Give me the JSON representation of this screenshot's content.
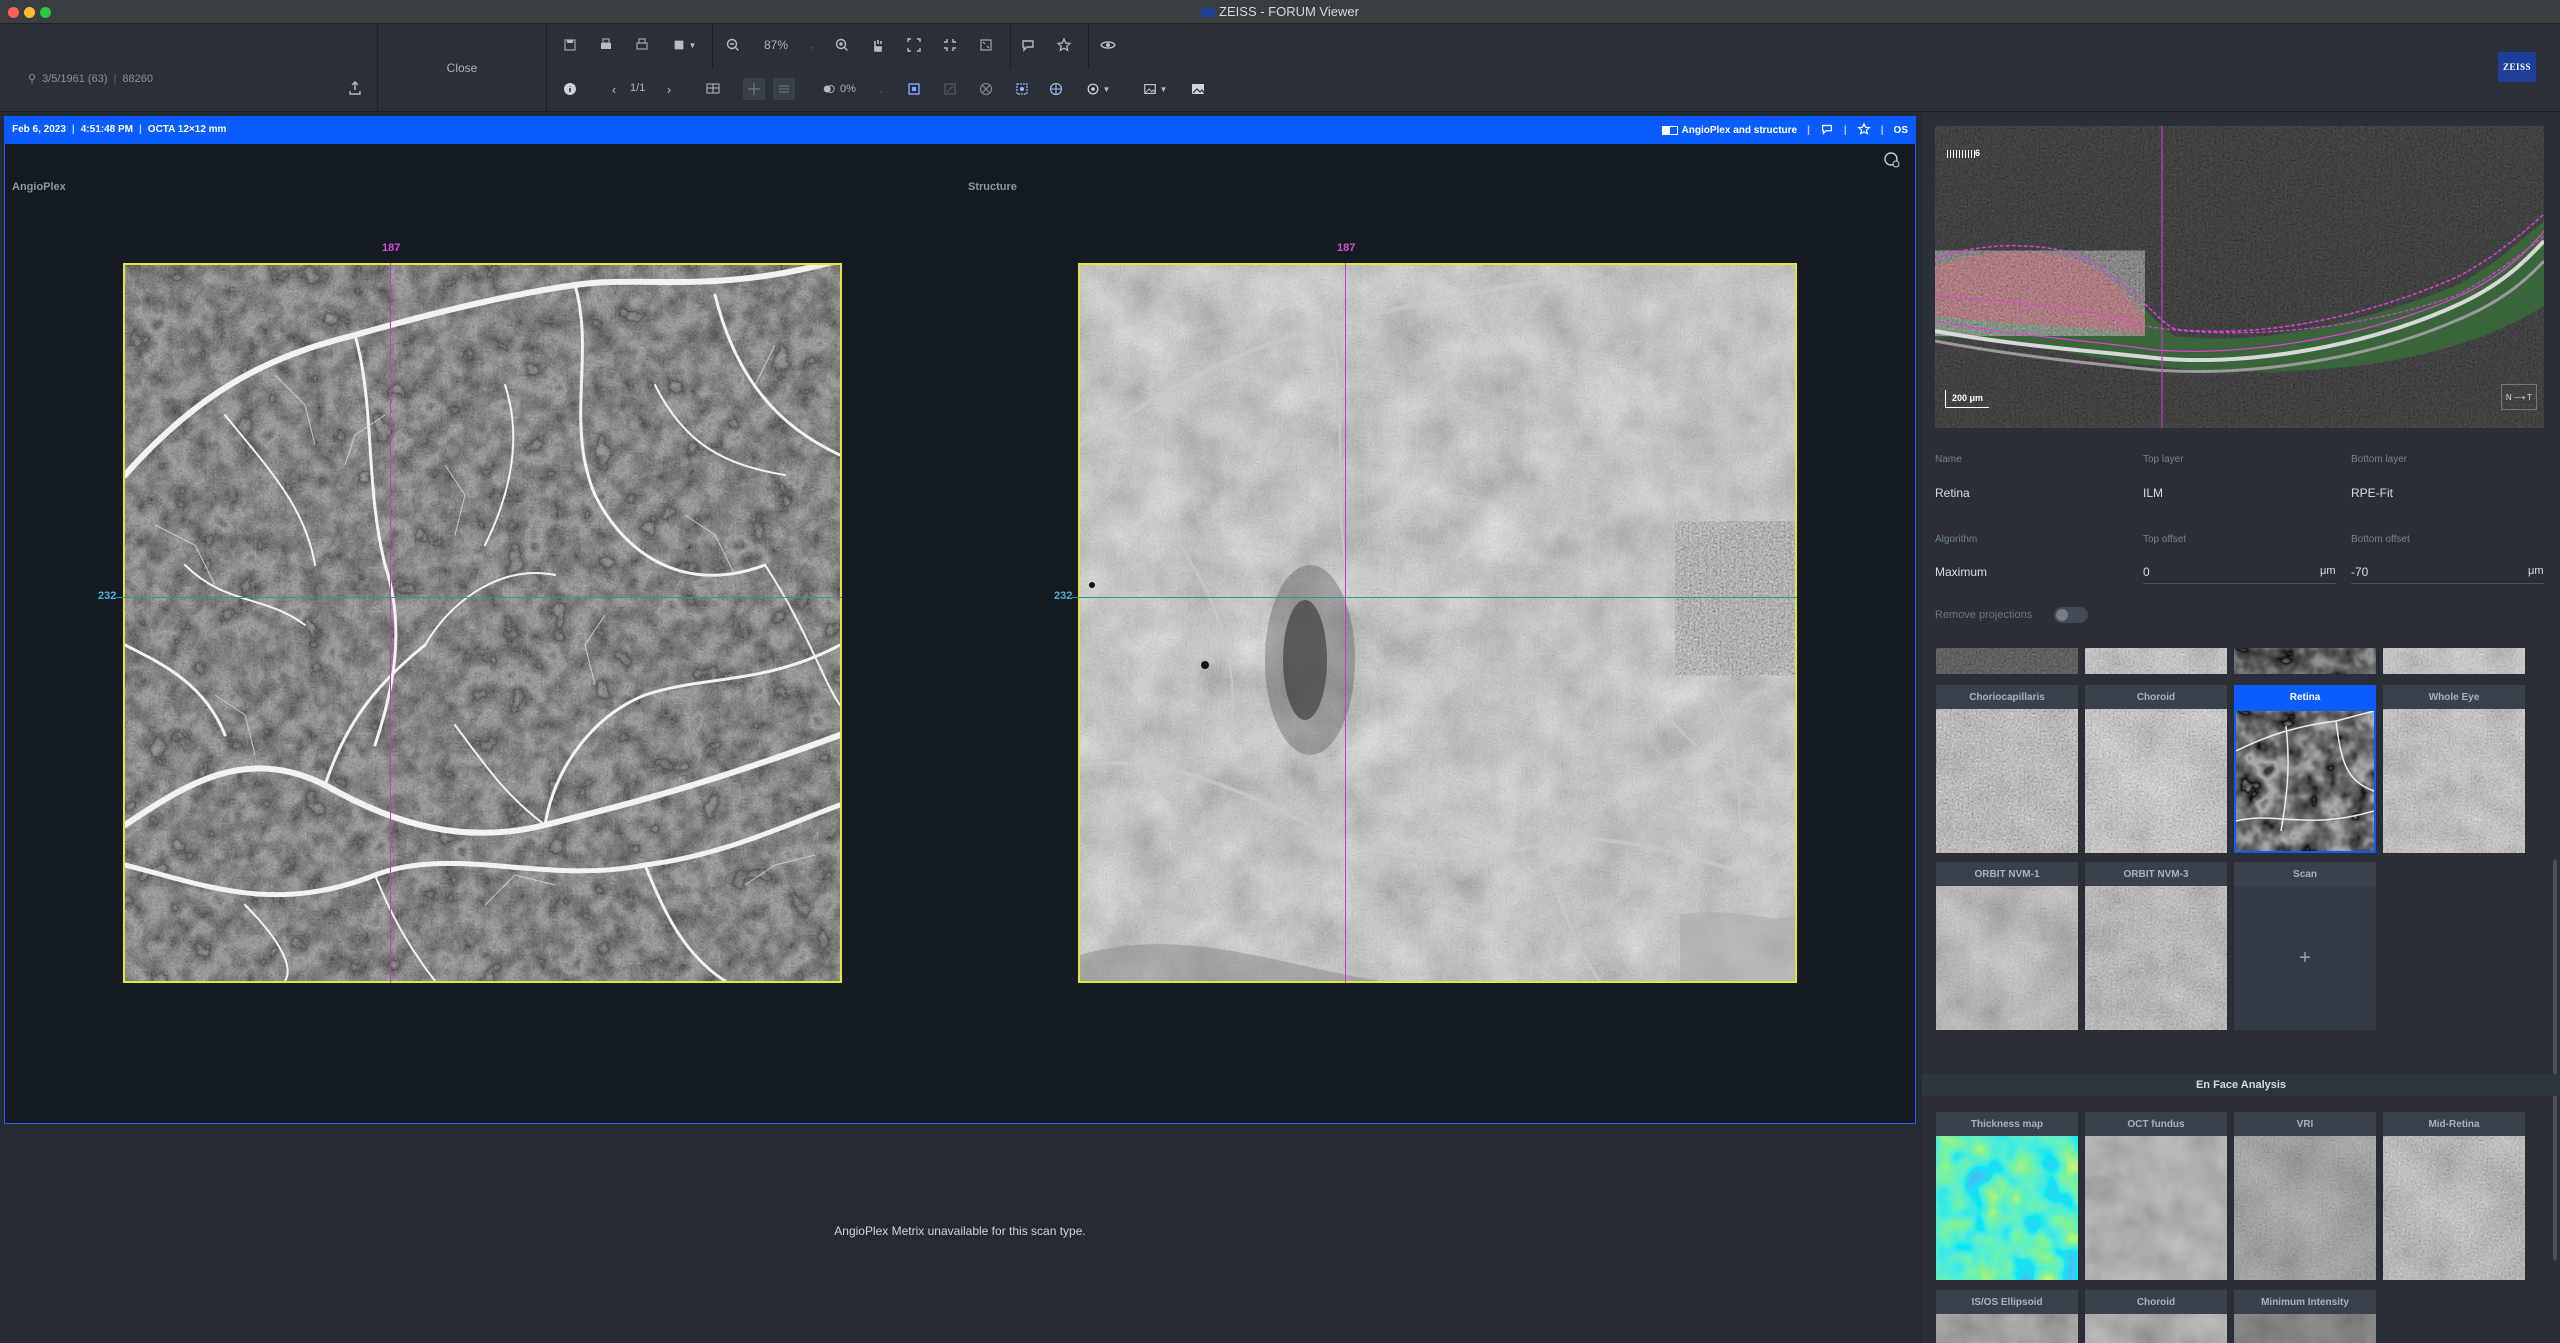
{
  "window": {
    "title": "ZEISS - FORUM Viewer"
  },
  "patient": {
    "dob_age": "3/5/1961 (63)",
    "id": "88260"
  },
  "toolbar": {
    "close_label": "Close",
    "zoom_value": "87%",
    "page_value": "1/1",
    "transparency_value": "0%"
  },
  "brand": {
    "logo_text": "ZEISS",
    "color": "#1d3f9a"
  },
  "info_bar": {
    "date": "Feb 6, 2023",
    "time": "4:51:48 PM",
    "scan": "OCTA 12×12 mm",
    "layout_label": "AngioPlex and structure",
    "eye": "OS",
    "accent": "#0a5cff"
  },
  "views": {
    "left": {
      "label": "AngioPlex",
      "x_coord": "187",
      "y_coord": "232"
    },
    "right": {
      "label": "Structure",
      "x_coord": "187",
      "y_coord": "232"
    }
  },
  "metrix_message": "AngioPlex Metrix unavailable for this scan type.",
  "bscan": {
    "slice_label": "6",
    "scale_label": "200 μm",
    "orient_n": "N",
    "orient_t": "T"
  },
  "layer": {
    "name_label": "Name",
    "name_value": "Retina",
    "top_layer_label": "Top layer",
    "top_layer_value": "ILM",
    "bottom_layer_label": "Bottom layer",
    "bottom_layer_value": "RPE-Fit",
    "algorithm_label": "Algorithm",
    "algorithm_value": "Maximum",
    "top_offset_label": "Top offset",
    "top_offset_value": "0",
    "bottom_offset_label": "Bottom offset",
    "bottom_offset_value": "-70",
    "unit": "μm",
    "remove_projections_label": "Remove projections"
  },
  "slabs": [
    {
      "label": "Choriocapillaris",
      "selected": false
    },
    {
      "label": "Choroid",
      "selected": false
    },
    {
      "label": "Retina",
      "selected": true
    },
    {
      "label": "Whole Eye",
      "selected": false
    },
    {
      "label": "ORBIT NVM-1",
      "selected": false
    },
    {
      "label": "ORBIT NVM-3",
      "selected": false
    },
    {
      "label": "Scan",
      "selected": false,
      "add": "+"
    }
  ],
  "enface": {
    "title": "En Face Analysis",
    "tiles": [
      {
        "label": "Thickness map"
      },
      {
        "label": "OCT fundus"
      },
      {
        "label": "VRI"
      },
      {
        "label": "Mid-Retina"
      },
      {
        "label": "IS/OS Ellipsoid"
      },
      {
        "label": "Choroid"
      },
      {
        "label": "Minimum Intensity"
      }
    ]
  },
  "colors": {
    "frame": "#e6e63a",
    "crosshair_v": "#c23bc2",
    "crosshair_h": "#3c8ea8"
  }
}
